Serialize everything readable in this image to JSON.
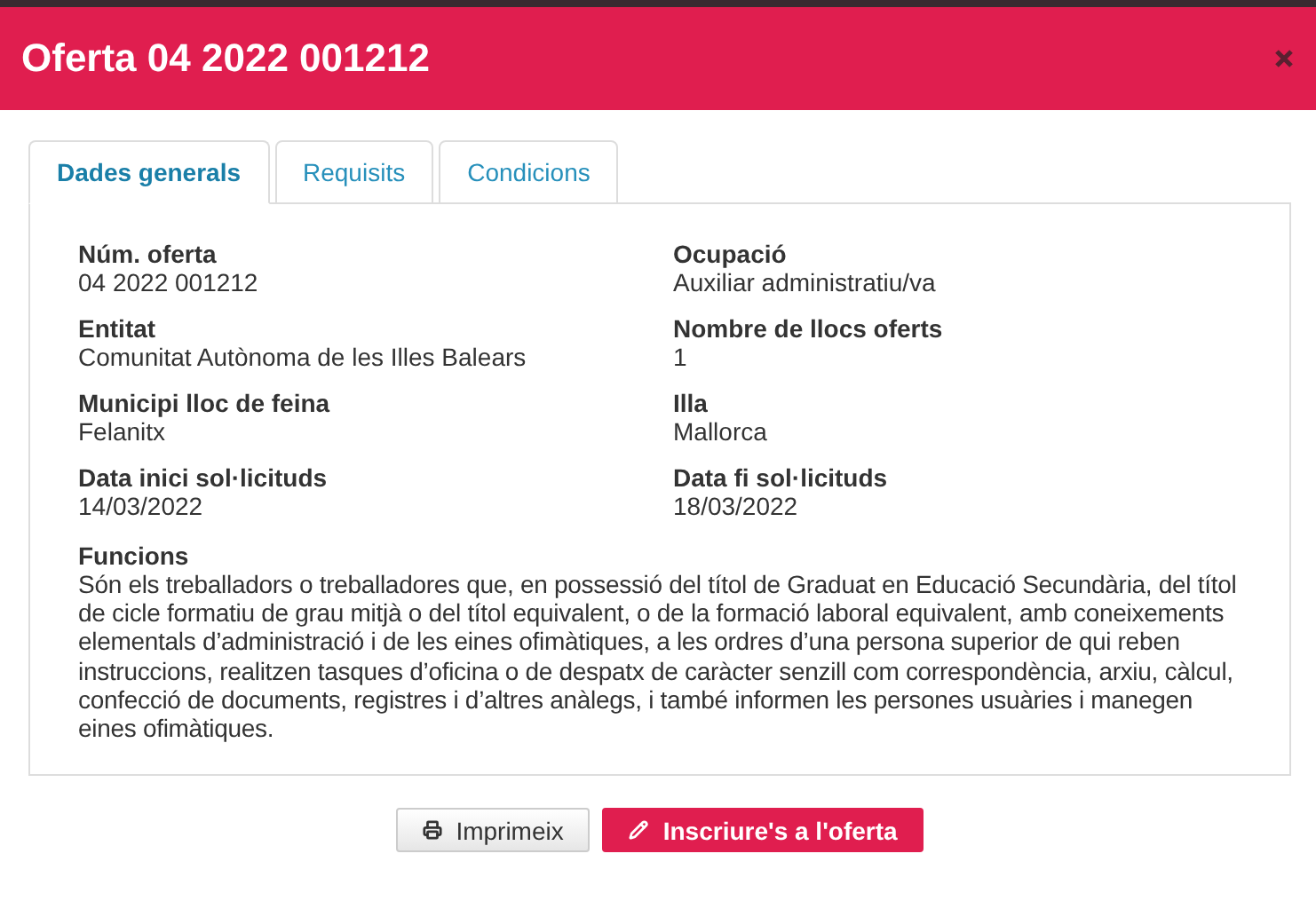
{
  "dialog": {
    "title": "Oferta 04 2022 001212"
  },
  "tabs": [
    {
      "label": "Dades generals",
      "selected": true
    },
    {
      "label": "Requisits",
      "selected": false
    },
    {
      "label": "Condicions",
      "selected": false
    }
  ],
  "fields": [
    {
      "label": "Núm. oferta",
      "value": "04 2022 001212"
    },
    {
      "label": "Ocupació",
      "value": "Auxiliar administratiu/va"
    },
    {
      "label": "Entitat",
      "value": "Comunitat Autònoma de les Illes Balears"
    },
    {
      "label": "Nombre de llocs oferts",
      "value": "1"
    },
    {
      "label": "Municipi lloc de feina",
      "value": "Felanitx"
    },
    {
      "label": "Illa",
      "value": "Mallorca"
    },
    {
      "label": "Data inici sol·licituds",
      "value": "14/03/2022"
    },
    {
      "label": "Data fi sol·licituds",
      "value": "18/03/2022"
    }
  ],
  "functions": {
    "label": "Funcions",
    "text": "Són els treballadors o treballadores que, en possessió del títol de Graduat en Educació Secundària, del títol de cicle formatiu de grau mitjà o del títol equivalent, o de la formació laboral equivalent, amb coneixements elementals d’administració i de les eines ofimàtiques, a les ordres d’una persona superior de qui reben instruccions, realitzen tasques d’oficina o de despatx de caràcter senzill com correspondència, arxiu, càlcul, confecció de documents, registres i d’altres anàlegs, i també informen les persones usuàries i manegen eines ofimàtiques."
  },
  "buttons": [
    {
      "kind": "default",
      "label": "Imprimeix"
    },
    {
      "kind": "primary",
      "label": "Inscriure's a l'oferta"
    }
  ]
}
